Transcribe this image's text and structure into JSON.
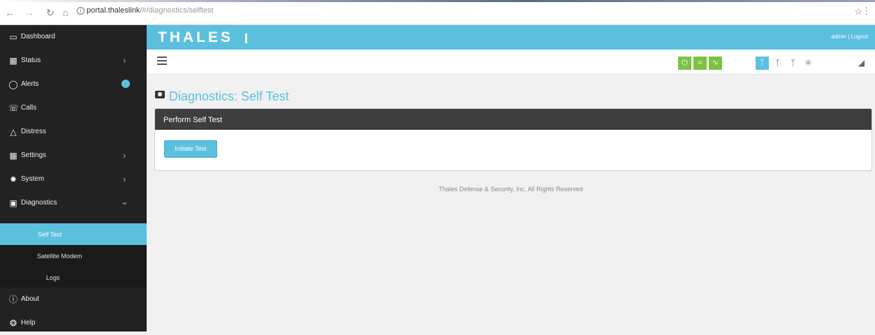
{
  "browser": {
    "back_icon": "back-arrow-icon",
    "address_domain": "portal.thaleslink",
    "address_path": "/#/diagnostics/selftest",
    "info_glyph": "i"
  },
  "header": {
    "logo": "THALES",
    "user_links": "admin | Logout"
  },
  "sidebar": {
    "items": [
      {
        "label": "Dashboard",
        "icon": "monitor-icon"
      },
      {
        "label": "Status",
        "icon": "bar-chart-icon"
      },
      {
        "label": "Alerts",
        "icon": "alarm-icon"
      },
      {
        "label": "Calls",
        "icon": "phone-icon"
      },
      {
        "label": "Distress",
        "icon": "warning-icon"
      },
      {
        "label": "Settings",
        "icon": "sliders-icon"
      },
      {
        "label": "System",
        "icon": "gear-icon"
      },
      {
        "label": "Diagnostics",
        "icon": "medkit-icon"
      },
      {
        "label": "About",
        "icon": "info-icon"
      },
      {
        "label": "Help",
        "icon": "lifebuoy-icon"
      }
    ],
    "subitems": [
      {
        "label": "Self Test"
      },
      {
        "label": "Satellite Modem"
      },
      {
        "label": "Logs"
      }
    ]
  },
  "main": {
    "page_title": "Diagnostics: Self Test",
    "panel_title": "Perform Self Test",
    "button_label": "Initiate Test",
    "footer": "Thales Defense & Security, Inc. All Rights Reserved"
  },
  "colors": {
    "accent": "#5bc0de",
    "sidebar_bg": "#222222",
    "panel_head": "#3d3d3d",
    "status_green": "#7cc243"
  }
}
